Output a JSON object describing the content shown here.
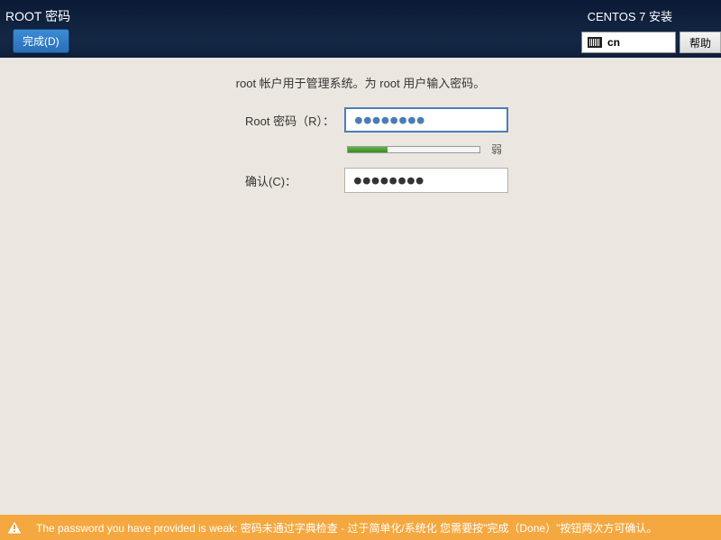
{
  "header": {
    "title": "ROOT 密码",
    "done_label": "完成(D)",
    "install_title": "CENTOS 7 安装",
    "keyboard_lang": "cn",
    "help_label": "帮助"
  },
  "form": {
    "instruction": "root 帐户用于管理系统。为 root 用户输入密码。",
    "password_label": "Root 密码（R）：",
    "password_value": "●●●●●●●●",
    "confirm_label": "确认(C)：",
    "confirm_value": "●●●●●●●●",
    "strength_label": "弱"
  },
  "warning": {
    "text": "The password you have provided is weak: 密码未通过字典检查 - 过于简单化/系统化 您需要按\"完成（Done）\"按钮两次方可确认。"
  }
}
